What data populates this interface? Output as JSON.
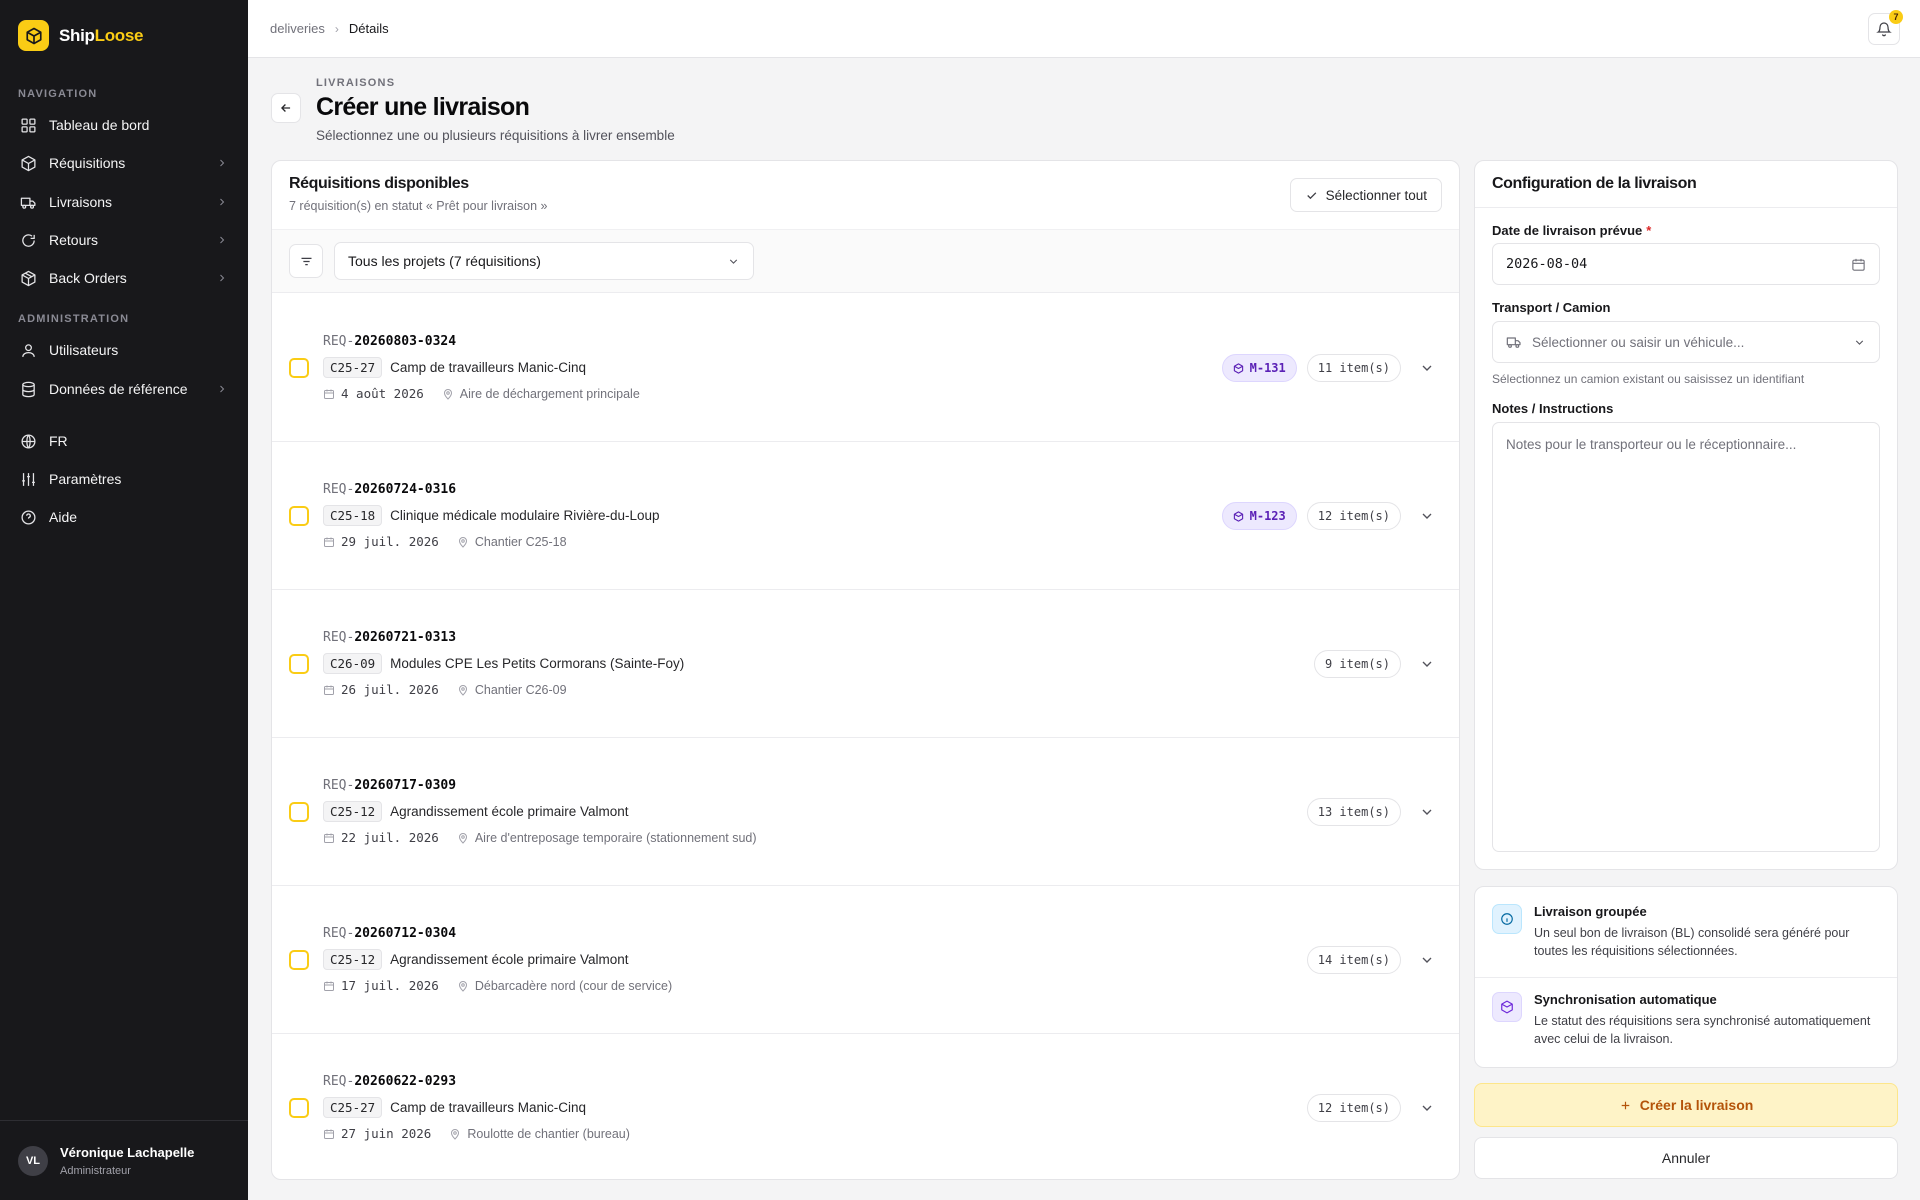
{
  "brand": {
    "name_part1": "Ship",
    "name_part2": "Loose"
  },
  "sidebar": {
    "nav_heading": "NAVIGATION",
    "admin_heading": "ADMINISTRATION",
    "items": [
      {
        "label": "Tableau de bord",
        "icon": "dashboard-icon"
      },
      {
        "label": "Réquisitions",
        "icon": "box-icon"
      },
      {
        "label": "Livraisons",
        "icon": "truck-icon"
      },
      {
        "label": "Retours",
        "icon": "return-icon"
      },
      {
        "label": "Back Orders",
        "icon": "package-icon"
      },
      {
        "label": "Utilisateurs",
        "icon": "user-icon"
      },
      {
        "label": "Données de référence",
        "icon": "database-icon"
      },
      {
        "label": "FR",
        "icon": "globe-icon"
      },
      {
        "label": "Paramètres",
        "icon": "sliders-icon"
      },
      {
        "label": "Aide",
        "icon": "help-icon"
      }
    ],
    "user": {
      "initials": "VL",
      "name": "Véronique Lachapelle",
      "role": "Administrateur"
    }
  },
  "topbar": {
    "breadcrumb": [
      "deliveries",
      "Détails"
    ],
    "notification_count": "7"
  },
  "header": {
    "eyebrow": "LIVRAISONS",
    "title": "Créer une livraison",
    "subtitle": "Sélectionnez une ou plusieurs réquisitions à livrer ensemble"
  },
  "requisitions": {
    "title": "Réquisitions disponibles",
    "subtitle": "7 réquisition(s) en statut « Prêt pour livraison »",
    "select_all": "Sélectionner tout",
    "project_filter": "Tous les projets (7 réquisitions)",
    "rows": [
      {
        "prefix": "REQ-",
        "number": "20260803-0324",
        "code": "C25-27",
        "project": "Camp de travailleurs Manic-Cinq",
        "date": "4 août 2026",
        "location": "Aire de déchargement principale",
        "module": "M-131",
        "items": "11 item(s)"
      },
      {
        "prefix": "REQ-",
        "number": "20260724-0316",
        "code": "C25-18",
        "project": "Clinique médicale modulaire Rivière-du-Loup",
        "date": "29 juil. 2026",
        "location": "Chantier C25-18",
        "module": "M-123",
        "items": "12 item(s)"
      },
      {
        "prefix": "REQ-",
        "number": "20260721-0313",
        "code": "C26-09",
        "project": "Modules CPE Les Petits Cormorans (Sainte-Foy)",
        "date": "26 juil. 2026",
        "location": "Chantier C26-09",
        "module": "",
        "items": "9 item(s)"
      },
      {
        "prefix": "REQ-",
        "number": "20260717-0309",
        "code": "C25-12",
        "project": "Agrandissement école primaire Valmont",
        "date": "22 juil. 2026",
        "location": "Aire d'entreposage temporaire (stationnement sud)",
        "module": "",
        "items": "13 item(s)"
      },
      {
        "prefix": "REQ-",
        "number": "20260712-0304",
        "code": "C25-12",
        "project": "Agrandissement école primaire Valmont",
        "date": "17 juil. 2026",
        "location": "Débarcadère nord (cour de service)",
        "module": "",
        "items": "14 item(s)"
      },
      {
        "prefix": "REQ-",
        "number": "20260622-0293",
        "code": "C25-27",
        "project": "Camp de travailleurs Manic-Cinq",
        "date": "27 juin 2026",
        "location": "Roulotte de chantier (bureau)",
        "module": "",
        "items": "12 item(s)"
      }
    ]
  },
  "config": {
    "title": "Configuration de la livraison",
    "date_label": "Date de livraison prévue",
    "date_required": "*",
    "date_value": "2026-08-04",
    "transport_label": "Transport / Camion",
    "transport_placeholder": "Sélectionner ou saisir un véhicule...",
    "transport_hint": "Sélectionnez un camion existant ou saisissez un identifiant",
    "notes_label": "Notes / Instructions",
    "notes_placeholder": "Notes pour le transporteur ou le réceptionnaire..."
  },
  "info": {
    "grouped_title": "Livraison groupée",
    "grouped_text": "Un seul bon de livraison (BL) consolidé sera généré pour toutes les réquisitions sélectionnées.",
    "sync_title": "Synchronisation automatique",
    "sync_text": "Le statut des réquisitions sera synchronisé automatiquement avec celui de la livraison."
  },
  "actions": {
    "create": "Créer la livraison",
    "cancel": "Annuler"
  },
  "colors": {
    "accent": "#facc15",
    "sidebar_bg": "#18181b",
    "module_badge": "#ede9fe"
  }
}
